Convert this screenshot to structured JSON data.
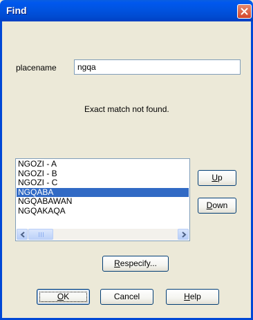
{
  "dialog": {
    "title": "Find"
  },
  "placename": {
    "label": "placename",
    "value": "ngqa"
  },
  "status": "Exact match not found.",
  "results": {
    "items": [
      "NGOZI - A",
      "NGOZI - B",
      "NGOZI - C",
      "NGQABA",
      "NGQABAWAN",
      "NGQAKAQA"
    ],
    "selected_index": 3
  },
  "buttons": {
    "up": {
      "mnemonic": "U",
      "rest": "p"
    },
    "down": {
      "mnemonic": "D",
      "rest": "own"
    },
    "respecify": {
      "mnemonic": "R",
      "rest": "especify..."
    },
    "ok": {
      "mnemonic": "O",
      "rest": "K"
    },
    "cancel": {
      "label": "Cancel"
    },
    "help": {
      "mnemonic": "H",
      "rest": "elp"
    }
  }
}
